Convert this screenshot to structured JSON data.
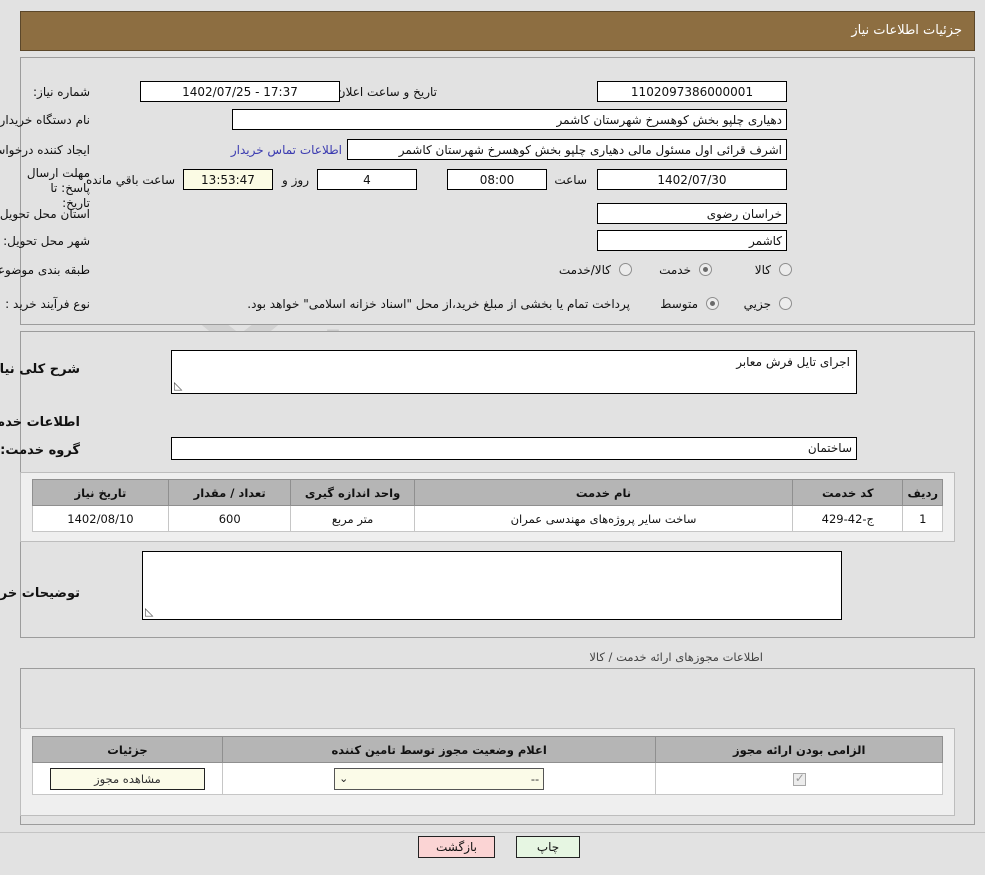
{
  "header": {
    "title": "جزئیات اطلاعات نیاز"
  },
  "watermark": {
    "text": "anaTender.net"
  },
  "info": {
    "need_number_label": "شماره نیاز:",
    "need_number_value": "1102097386000001",
    "announce_datetime_label": "تاریخ و ساعت اعلان عمومی:",
    "announce_datetime_value": "1402/07/25 - 17:37",
    "buyer_org_label": "نام دستگاه خریدار:",
    "buyer_org_value": "دهیاری چلپو بخش کوهسرخ شهرستان کاشمر",
    "requester_label": "ایجاد کننده درخواست:",
    "requester_value": "اشرف قرائی اول مسئول مالی دهیاری چلپو بخش کوهسرخ شهرستان کاشمر",
    "contact_link": "اطلاعات تماس خریدار",
    "deadline_label": "مهلت ارسال پاسخ: تا تاریخ:",
    "deadline_date": "1402/07/30",
    "deadline_hour_label": "ساعت",
    "deadline_hour": "08:00",
    "days_remaining": "4",
    "days_label": "روز و",
    "countdown": "13:53:47",
    "countdown_label": "ساعت باقي مانده",
    "province_label": "استان محل تحویل:",
    "province_value": "خراسان رضوی",
    "city_label": "شهر محل تحویل:",
    "city_value": "کاشمر",
    "category_label": "طبقه بندی موضوعی:",
    "category_options": [
      {
        "label": "کالا",
        "selected": false
      },
      {
        "label": "خدمت",
        "selected": true
      },
      {
        "label": "کالا/خدمت",
        "selected": false
      }
    ],
    "process_label": "نوع فرآیند خرید :",
    "process_options": [
      {
        "label": "جزيي",
        "selected": false
      },
      {
        "label": "متوسط",
        "selected": true
      }
    ],
    "payment_note": "پرداخت تمام یا بخشی از مبلغ خرید،از محل \"اسناد خزانه اسلامی\" خواهد بود."
  },
  "detail": {
    "general_desc_label": "شرح کلی نیاز:",
    "general_desc_value": "اجرای تایل فرش معابر",
    "services_info_title": "اطلاعات خدمات مورد نیاز",
    "service_group_label": "گروه خدمت:",
    "service_group_value": "ساختمان",
    "buyer_comments_label": "توضیحات خریدار:",
    "buyer_comments_value": ""
  },
  "items_table": {
    "columns": [
      "ردیف",
      "کد خدمت",
      "نام خدمت",
      "واحد اندازه گیری",
      "تعداد / مقدار",
      "تاریخ نیاز"
    ],
    "rows": [
      {
        "row": "1",
        "code": "ج-42-429",
        "name": "ساخت سایر پروژه‌های مهندسی عمران",
        "unit": "متر مربع",
        "qty": "600",
        "date": "1402/08/10"
      }
    ]
  },
  "permits": {
    "section_title": "اطلاعات مجوزهای ارائه خدمت / کالا",
    "columns": [
      "الزامی بودن ارائه مجوز",
      "اعلام وضعیت مجوز توسط تامین کننده",
      "جزئیات"
    ],
    "rows": [
      {
        "required_checked": true,
        "status_value": "--",
        "details_button": "مشاهده مجوز"
      }
    ]
  },
  "footer": {
    "print_label": "چاپ",
    "back_label": "بازگشت"
  },
  "colors": {
    "header_brown": "#8d6e41",
    "page_bg": "#e2e2e2",
    "table_header": "#b5b5b5",
    "link_blue": "#3a3ab0",
    "print_green": "#e6f6e2",
    "back_pink": "#fbd4d4",
    "countdown_yellow": "#fbfbe4"
  }
}
